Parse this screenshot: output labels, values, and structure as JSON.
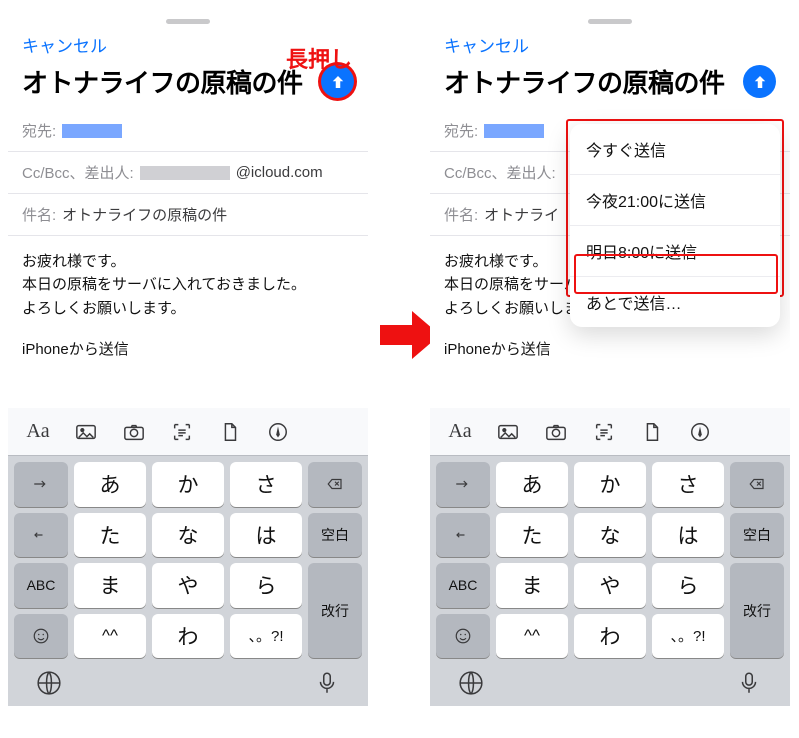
{
  "annotations": {
    "long_press": "長押し"
  },
  "topbar": {
    "cancel": "キャンセル"
  },
  "title": "オトナライフの原稿の件",
  "fields": {
    "to_label": "宛先:",
    "cc_label": "Cc/Bcc、差出人:",
    "cc_suffix": "@icloud.com",
    "subject_label": "件名:",
    "subject_value": "オトナライフの原稿の件"
  },
  "body": {
    "line1": "お疲れ様です。",
    "line2": "本日の原稿をサーバに入れておきました。",
    "line3": "よろしくお願いします",
    "line3_end": "。",
    "sig": "iPhoneから送信"
  },
  "menu": {
    "item1": "今すぐ送信",
    "item2": "今夜21:00に送信",
    "item3": "明日8:00に送信",
    "item4": "あとで送信…"
  },
  "keyboard": {
    "toolbar_aa": "Aa",
    "rows": {
      "r1c1": "あ",
      "r1c2": "か",
      "r1c3": "さ",
      "r2c1": "た",
      "r2c2": "な",
      "r2c3": "は",
      "r2_side": "空白",
      "r3c1": "ま",
      "r3c2": "や",
      "r3c3": "ら",
      "r3_abc": "ABC",
      "r4c1": "^^",
      "r4c2": "わ",
      "r4c3": "、。?!",
      "r34_side": "改行"
    }
  },
  "right": {
    "body_line1_trunc": "お疲れ様です",
    "subject_trunc": "オトナライ"
  }
}
